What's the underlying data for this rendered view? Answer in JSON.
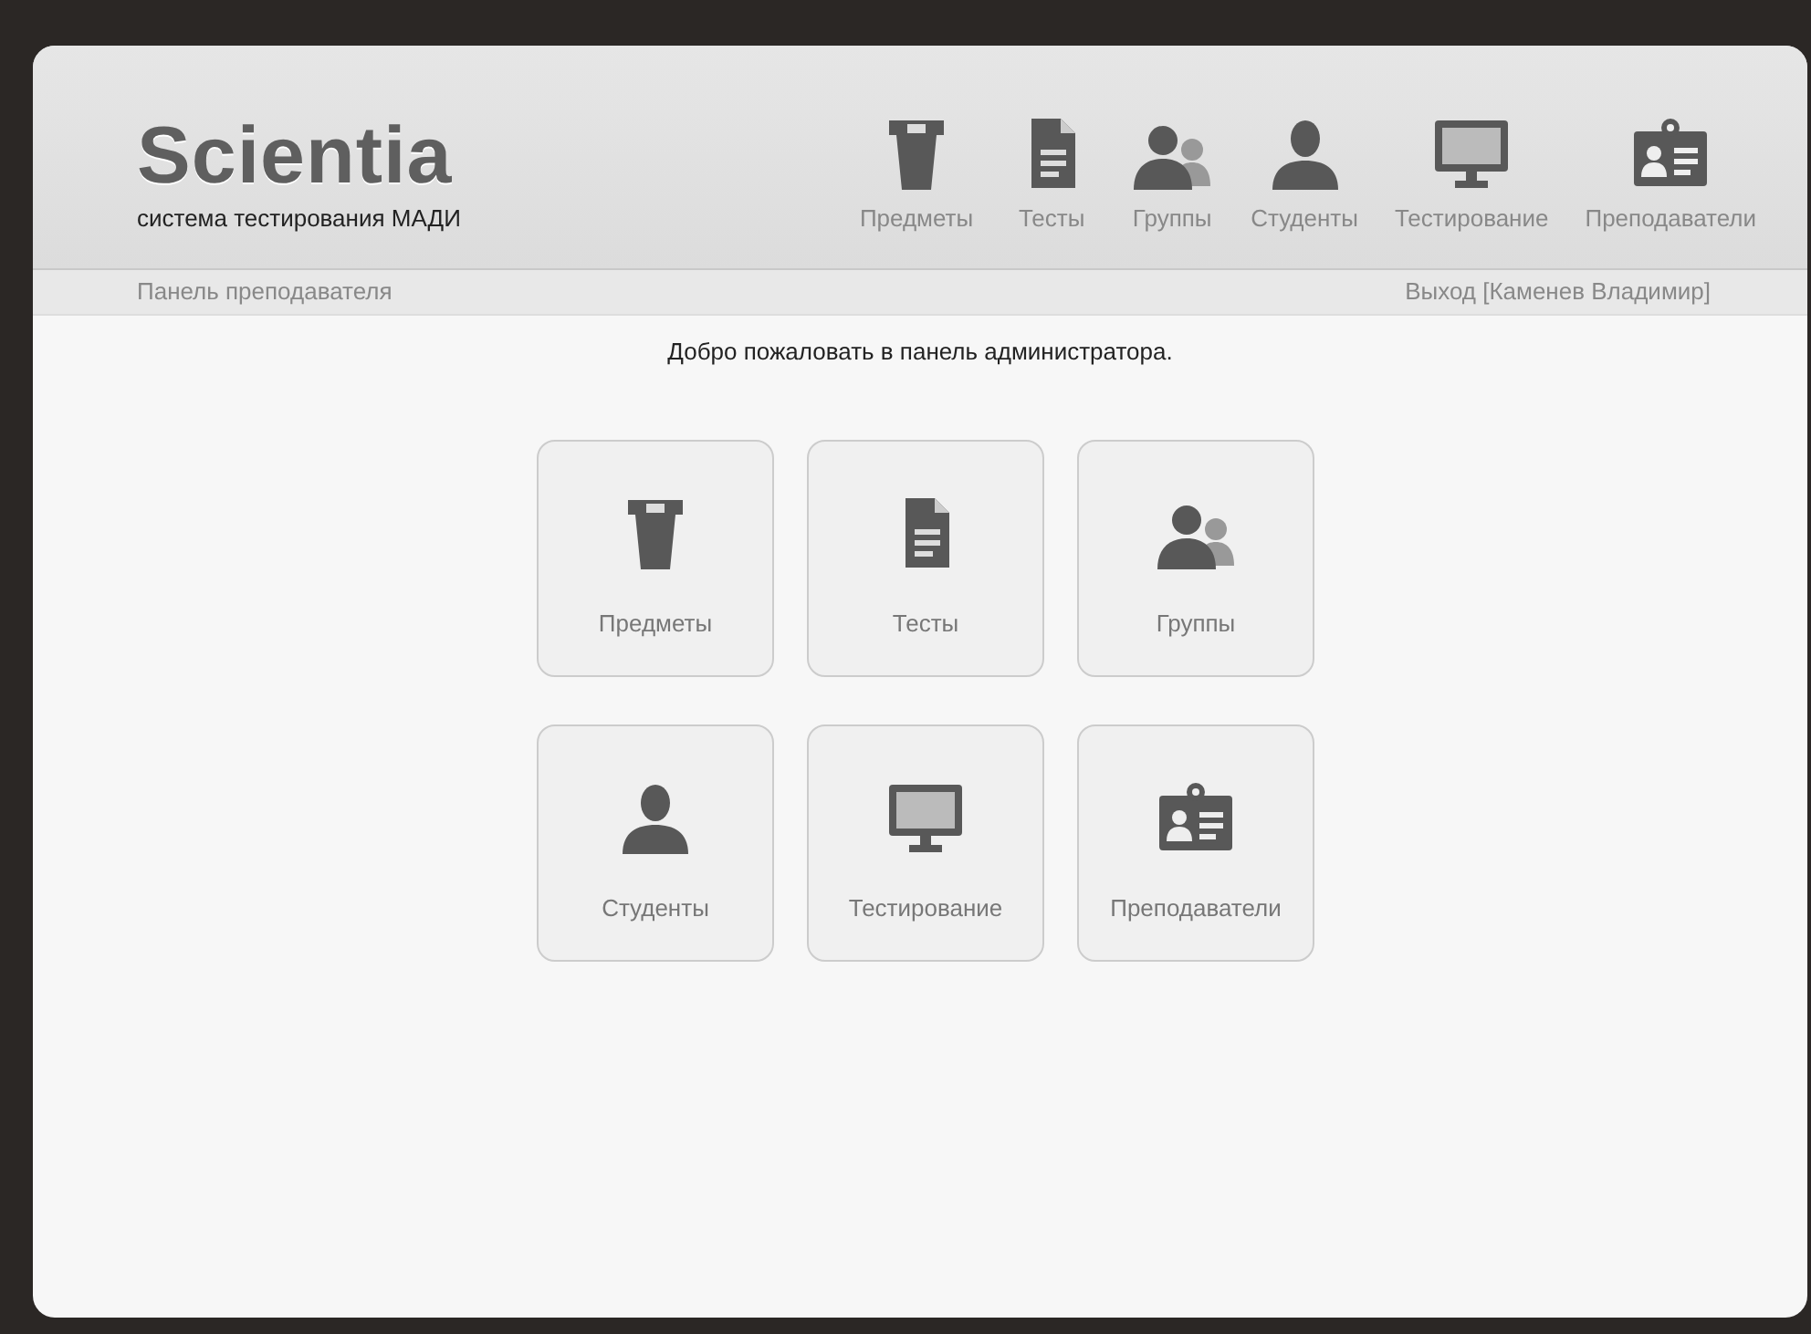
{
  "header": {
    "logo": "Scientia",
    "subtitle": "система тестирования МАДИ"
  },
  "nav": [
    {
      "label": "Предметы",
      "kind": "podium"
    },
    {
      "label": "Тесты",
      "kind": "document"
    },
    {
      "label": "Группы",
      "kind": "group"
    },
    {
      "label": "Студенты",
      "kind": "person"
    },
    {
      "label": "Тестирование",
      "kind": "monitor"
    },
    {
      "label": "Преподаватели",
      "kind": "badge"
    }
  ],
  "subbar": {
    "left": "Панель преподавателя",
    "right": "Выход [Каменев Владимир]"
  },
  "welcome": "Добро пожаловать в панель администратора.",
  "tiles": [
    {
      "label": "Предметы",
      "kind": "podium"
    },
    {
      "label": "Тесты",
      "kind": "document"
    },
    {
      "label": "Группы",
      "kind": "group"
    },
    {
      "label": "Студенты",
      "kind": "person"
    },
    {
      "label": "Тестирование",
      "kind": "monitor"
    },
    {
      "label": "Преподаватели",
      "kind": "badge"
    }
  ]
}
